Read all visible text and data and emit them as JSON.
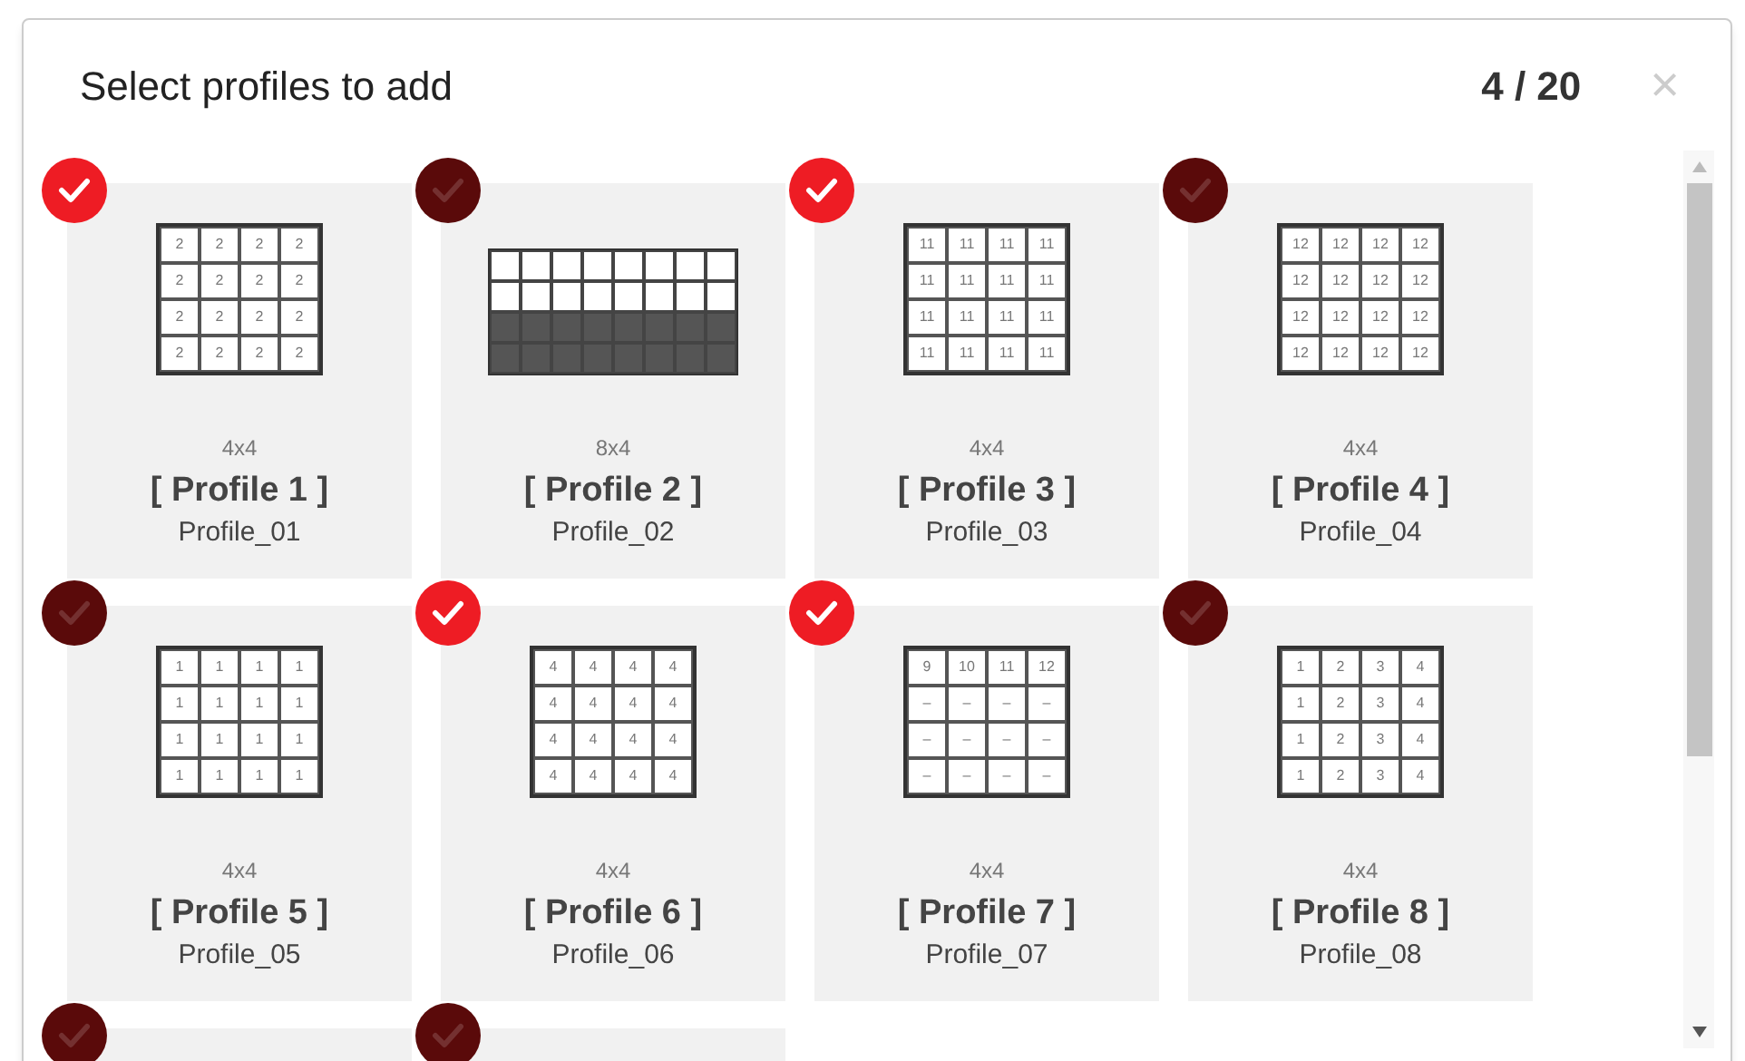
{
  "dialog": {
    "title": "Select profiles to add",
    "count": "4 / 20",
    "close": "×"
  },
  "profiles": [
    {
      "selected": true,
      "kind": "numbers",
      "rows": [
        [
          "2",
          "2",
          "2",
          "2"
        ],
        [
          "2",
          "2",
          "2",
          "2"
        ],
        [
          "2",
          "2",
          "2",
          "2"
        ],
        [
          "2",
          "2",
          "2",
          "2"
        ]
      ],
      "size": "4x4",
      "title": "[ Profile 1 ]",
      "name": "Profile_01"
    },
    {
      "selected": false,
      "kind": "blocks",
      "rows": [
        {
          "shaded": false
        },
        {
          "shaded": false
        },
        {
          "shaded": true
        },
        {
          "shaded": true
        }
      ],
      "size": "8x4",
      "title": "[ Profile 2 ]",
      "name": "Profile_02"
    },
    {
      "selected": true,
      "kind": "numbers",
      "rows": [
        [
          "11",
          "11",
          "11",
          "11"
        ],
        [
          "11",
          "11",
          "11",
          "11"
        ],
        [
          "11",
          "11",
          "11",
          "11"
        ],
        [
          "11",
          "11",
          "11",
          "11"
        ]
      ],
      "size": "4x4",
      "title": "[ Profile 3 ]",
      "name": "Profile_03"
    },
    {
      "selected": false,
      "kind": "numbers",
      "rows": [
        [
          "12",
          "12",
          "12",
          "12"
        ],
        [
          "12",
          "12",
          "12",
          "12"
        ],
        [
          "12",
          "12",
          "12",
          "12"
        ],
        [
          "12",
          "12",
          "12",
          "12"
        ]
      ],
      "size": "4x4",
      "title": "[ Profile 4 ]",
      "name": "Profile_04"
    },
    {
      "selected": false,
      "kind": "numbers",
      "rows": [
        [
          "1",
          "1",
          "1",
          "1"
        ],
        [
          "1",
          "1",
          "1",
          "1"
        ],
        [
          "1",
          "1",
          "1",
          "1"
        ],
        [
          "1",
          "1",
          "1",
          "1"
        ]
      ],
      "size": "4x4",
      "title": "[ Profile 5 ]",
      "name": "Profile_05"
    },
    {
      "selected": true,
      "kind": "numbers",
      "rows": [
        [
          "4",
          "4",
          "4",
          "4"
        ],
        [
          "4",
          "4",
          "4",
          "4"
        ],
        [
          "4",
          "4",
          "4",
          "4"
        ],
        [
          "4",
          "4",
          "4",
          "4"
        ]
      ],
      "size": "4x4",
      "title": "[ Profile 6 ]",
      "name": "Profile_06"
    },
    {
      "selected": true,
      "kind": "numbers",
      "rows": [
        [
          "9",
          "10",
          "11",
          "12"
        ],
        [
          "–",
          "–",
          "–",
          "–"
        ],
        [
          "–",
          "–",
          "–",
          "–"
        ],
        [
          "–",
          "–",
          "–",
          "–"
        ]
      ],
      "size": "4x4",
      "title": "[ Profile 7 ]",
      "name": "Profile_07"
    },
    {
      "selected": false,
      "kind": "numbers",
      "rows": [
        [
          "1",
          "2",
          "3",
          "4"
        ],
        [
          "1",
          "2",
          "3",
          "4"
        ],
        [
          "1",
          "2",
          "3",
          "4"
        ],
        [
          "1",
          "2",
          "3",
          "4"
        ]
      ],
      "size": "4x4",
      "title": "[ Profile 8 ]",
      "name": "Profile_08"
    },
    {
      "selected": false
    },
    {
      "selected": false
    }
  ]
}
